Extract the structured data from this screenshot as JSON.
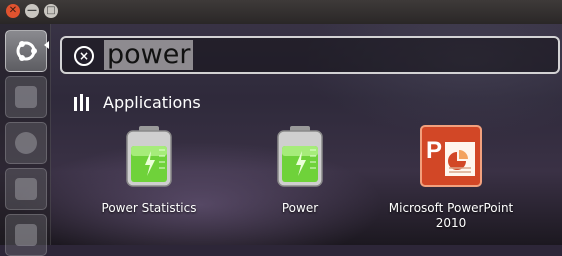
{
  "search": {
    "query": "power",
    "clear_icon": "clear-search-icon"
  },
  "lens": {
    "icon": "applications-lens-icon",
    "category": "Applications"
  },
  "results": [
    {
      "name": "Power Statistics",
      "icon": "battery-icon"
    },
    {
      "name": "Power",
      "icon": "battery-icon"
    },
    {
      "name": "Microsoft PowerPoint 2010",
      "icon": "powerpoint-icon"
    }
  ],
  "colors": {
    "battery_green": "#6fd23a",
    "powerpoint_orange": "#d24726"
  }
}
